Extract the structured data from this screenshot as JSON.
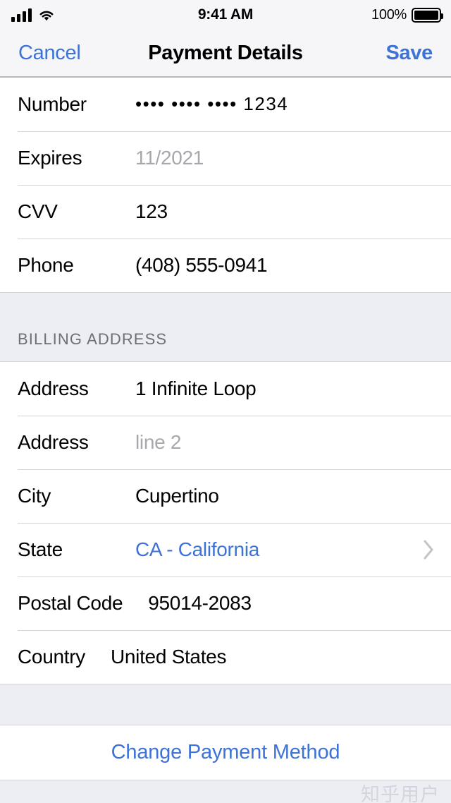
{
  "status_bar": {
    "time": "9:41 AM",
    "battery_percent": "100%",
    "signal_icon": "cellular-bars-icon",
    "wifi_icon": "wifi-icon",
    "battery_icon": "battery-full-icon"
  },
  "nav_bar": {
    "cancel_label": "Cancel",
    "title": "Payment Details",
    "save_label": "Save"
  },
  "colors": {
    "accent_blue": "#3d72d7",
    "placeholder_gray": "#a7a7ad",
    "section_bg": "#eceef3",
    "separator": "#d4d4d8"
  },
  "sections": [
    {
      "header": "",
      "rows": [
        {
          "label": "Number",
          "value": "•••• •••• •••• 1234",
          "state": "filled"
        },
        {
          "label": "Expires",
          "value": "11/2021",
          "state": "placeholder"
        },
        {
          "label": "CVV",
          "value": "123",
          "state": "filled"
        },
        {
          "label": "Phone",
          "value": "(408) 555-0941",
          "state": "filled"
        }
      ]
    },
    {
      "header": "BILLING ADDRESS",
      "rows": [
        {
          "label": "Address",
          "value": "1 Infinite Loop",
          "state": "filled"
        },
        {
          "label": "Address",
          "value": "line 2",
          "state": "placeholder"
        },
        {
          "label": "City",
          "value": "Cupertino",
          "state": "filled"
        },
        {
          "label": "State",
          "value": "CA - California",
          "state": "link",
          "accessory": "chevron-right-icon"
        },
        {
          "label": "Postal Code",
          "value": "95014-2083",
          "state": "filled",
          "wide_label": true
        },
        {
          "label": "Country",
          "value": "United States",
          "state": "filled",
          "wide_label": true
        }
      ]
    }
  ],
  "footer": {
    "change_payment_label": "Change Payment Method"
  },
  "watermark": {
    "text": "知乎用户"
  }
}
